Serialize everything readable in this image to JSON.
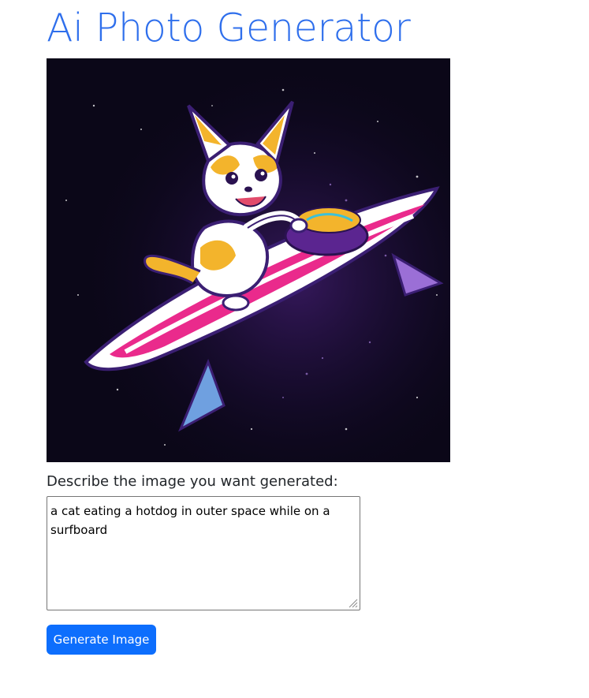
{
  "page": {
    "title": "Ai Photo Generator"
  },
  "generated_image": {
    "subject": "a cat eating a hotdog in outer space while on a surfboard"
  },
  "form": {
    "prompt_label": "Describe the image you want generated:",
    "prompt_value": "a cat eating a hotdog in outer space while on a surfboard",
    "submit_label": "Generate Image"
  },
  "colors": {
    "title": "#2f6fec",
    "button": "#0d6efd",
    "button_text": "#ffffff",
    "image_background": "#0b0718"
  }
}
